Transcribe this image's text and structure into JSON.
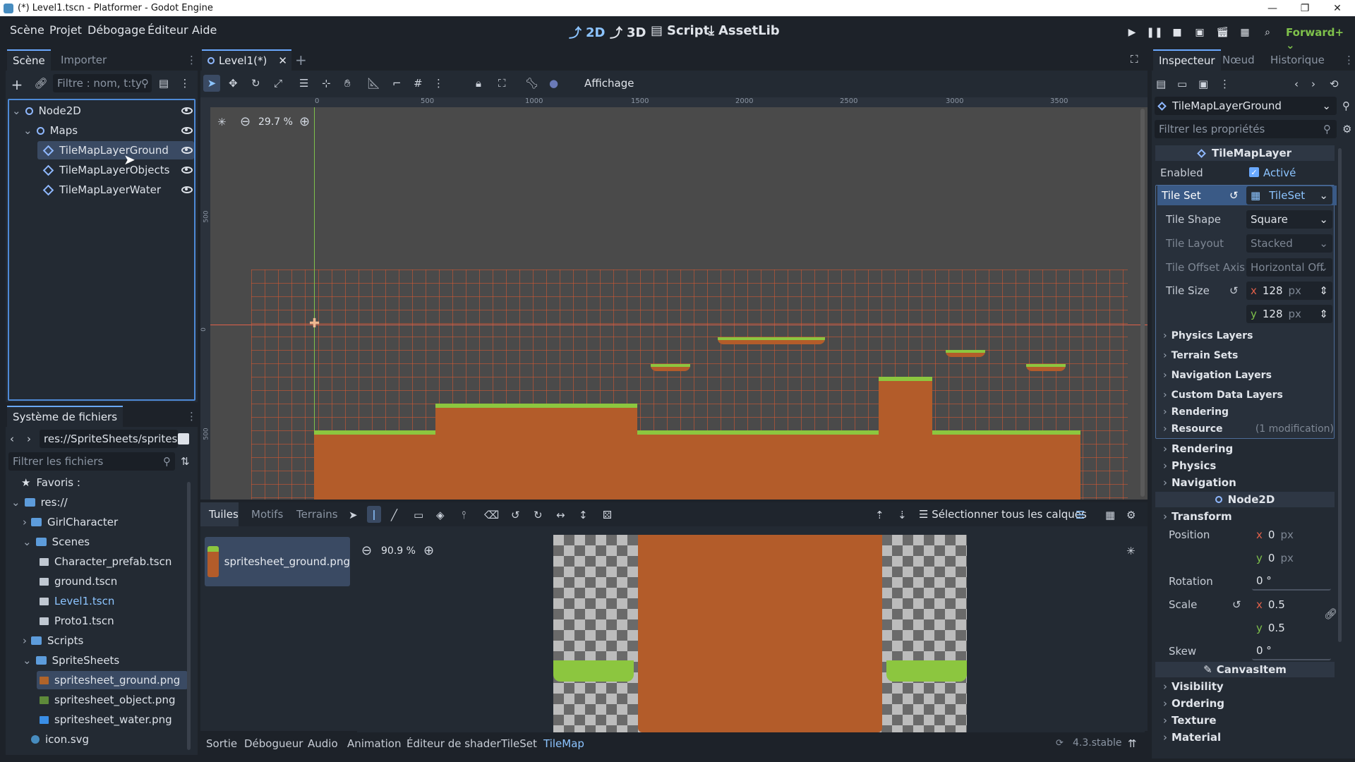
{
  "window": {
    "title": "(*) Level1.tscn - Platformer - Godot Engine"
  },
  "menu": [
    "Scène",
    "Projet",
    "Débogage",
    "Éditeur",
    "Aide"
  ],
  "modes": [
    {
      "label": "2D",
      "active": true
    },
    {
      "label": "3D",
      "active": false
    },
    {
      "label": "Script",
      "active": false
    },
    {
      "label": "AssetLib",
      "active": false
    }
  ],
  "renderer": "Forward+",
  "scene_dock": {
    "tabs": [
      "Scène",
      "Importer"
    ],
    "filter_placeholder": "Filtre : nom, t:ty",
    "nodes": [
      "Node2D",
      "Maps",
      "TileMapLayerGround",
      "TileMapLayerObjects",
      "TileMapLayerWater"
    ]
  },
  "filesystem": {
    "title": "Système de fichiers",
    "path": "res://SpriteSheets/spritesh",
    "filter_placeholder": "Filtrer les fichiers",
    "items": [
      "Favoris :",
      "res://",
      "GirlCharacter",
      "Scenes",
      "Character_prefab.tscn",
      "ground.tscn",
      "Level1.tscn",
      "Proto1.tscn",
      "Scripts",
      "SpriteSheets",
      "spritesheet_ground.png",
      "spritesheet_object.png",
      "spritesheet_water.png",
      "icon.svg"
    ]
  },
  "editor": {
    "tab": "Level1(*)",
    "view_menu": "Affichage",
    "zoom": "29.7 %",
    "ruler_ticks": [
      "0",
      "500",
      "1000",
      "1500",
      "2000",
      "2500",
      "3000",
      "3500"
    ],
    "vruler_ticks": [
      "500",
      "0",
      "500"
    ]
  },
  "tilemap_panel": {
    "tabs": [
      "Tuiles",
      "Motifs",
      "Terrains"
    ],
    "select_all_layers": "Sélectionner tous les calques",
    "source": "spritesheet_ground.png",
    "zoom": "90.9 %"
  },
  "bottom_tabs": [
    "Sortie",
    "Débogueur",
    "Audio",
    "Animation",
    "Éditeur de shader",
    "TileSet",
    "TileMap"
  ],
  "version": "4.3.stable",
  "inspector": {
    "tabs": [
      "Inspecteur",
      "Nœud",
      "Historique"
    ],
    "object": "TileMapLayerGround",
    "filter_placeholder": "Filtrer les propriétés",
    "class_header": "TileMapLayer",
    "enabled_label": "Enabled",
    "enabled_value": "Activé",
    "tileset_label": "Tile Set",
    "tileset_value": "TileSet",
    "tile_shape_label": "Tile Shape",
    "tile_shape": "Square",
    "tile_layout_label": "Tile Layout",
    "tile_layout": "Stacked",
    "tile_offset_label": "Tile Offset Axis",
    "tile_offset": "Horizontal Off",
    "tile_size_label": "Tile Size",
    "tile_size_x": "128",
    "tile_size_y": "128",
    "px": "px",
    "x": "x",
    "y": "y",
    "tileset_sections": [
      "Physics Layers",
      "Terrain Sets",
      "Navigation Layers",
      "Custom Data Layers",
      "Rendering"
    ],
    "resource_label": "Resource",
    "resource_note": "(1 modification)",
    "layer_sections": [
      "Rendering",
      "Physics",
      "Navigation"
    ],
    "node2d_header": "Node2D",
    "transform_label": "Transform",
    "position_label": "Position",
    "position_x": "0",
    "position_y": "0",
    "rotation_label": "Rotation",
    "rotation": "0 °",
    "scale_label": "Scale",
    "scale_x": "0.5",
    "scale_y": "0.5",
    "skew_label": "Skew",
    "skew": "0 °",
    "canvasitem_header": "CanvasItem",
    "canvas_sections": [
      "Visibility",
      "Ordering",
      "Texture",
      "Material"
    ]
  }
}
